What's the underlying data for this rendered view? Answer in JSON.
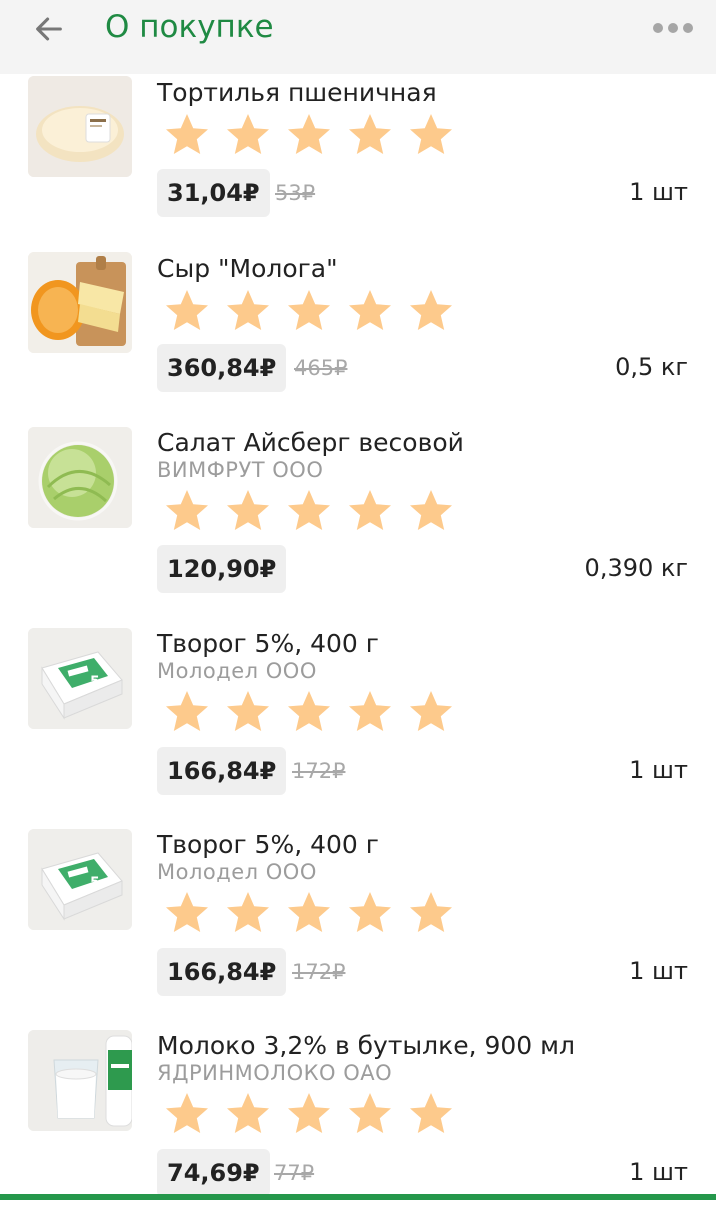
{
  "header": {
    "title": "О покупке",
    "back_icon": "arrow-left-icon",
    "more_icon": "more-horizontal-icon"
  },
  "colors": {
    "brand_green": "#1f8a43",
    "star": "#fdca8c",
    "bottom_bar": "#25974b"
  },
  "items": [
    {
      "name": "Тортилья пшеничная",
      "vendor": "",
      "price": "31,04₽",
      "old_price": "53₽",
      "quantity": "1 шт",
      "rating": 0,
      "stars_max": 5
    },
    {
      "name": "Сыр \"Molога\"",
      "vendor": "",
      "price": "360,84₽",
      "old_price": "465₽",
      "quantity": "0,5 кг",
      "rating": 0,
      "stars_max": 5
    },
    {
      "name": "Салат Айсберг весовой",
      "vendor": "ВИМФРУТ ООО",
      "price": "120,90₽",
      "old_price": "",
      "quantity": "0,390 кг",
      "rating": 0,
      "stars_max": 5
    },
    {
      "name": "Творог 5%, 400 г",
      "vendor": "Молодел ООО",
      "price": "166,84₽",
      "old_price": "172₽",
      "quantity": "1 шт",
      "rating": 0,
      "stars_max": 5
    },
    {
      "name": "Творог 5%, 400 г",
      "vendor": "Молодел ООО",
      "price": "166,84₽",
      "old_price": "172₽",
      "quantity": "1 шт",
      "rating": 0,
      "stars_max": 5
    },
    {
      "name": "Молоко 3,2% в бутылке, 900 мл",
      "vendor": "ЯДРИНМОЛОКО ОАО",
      "price": "74,69₽",
      "old_price": "77₽",
      "quantity": "1 шт",
      "rating": 0,
      "stars_max": 5
    }
  ]
}
